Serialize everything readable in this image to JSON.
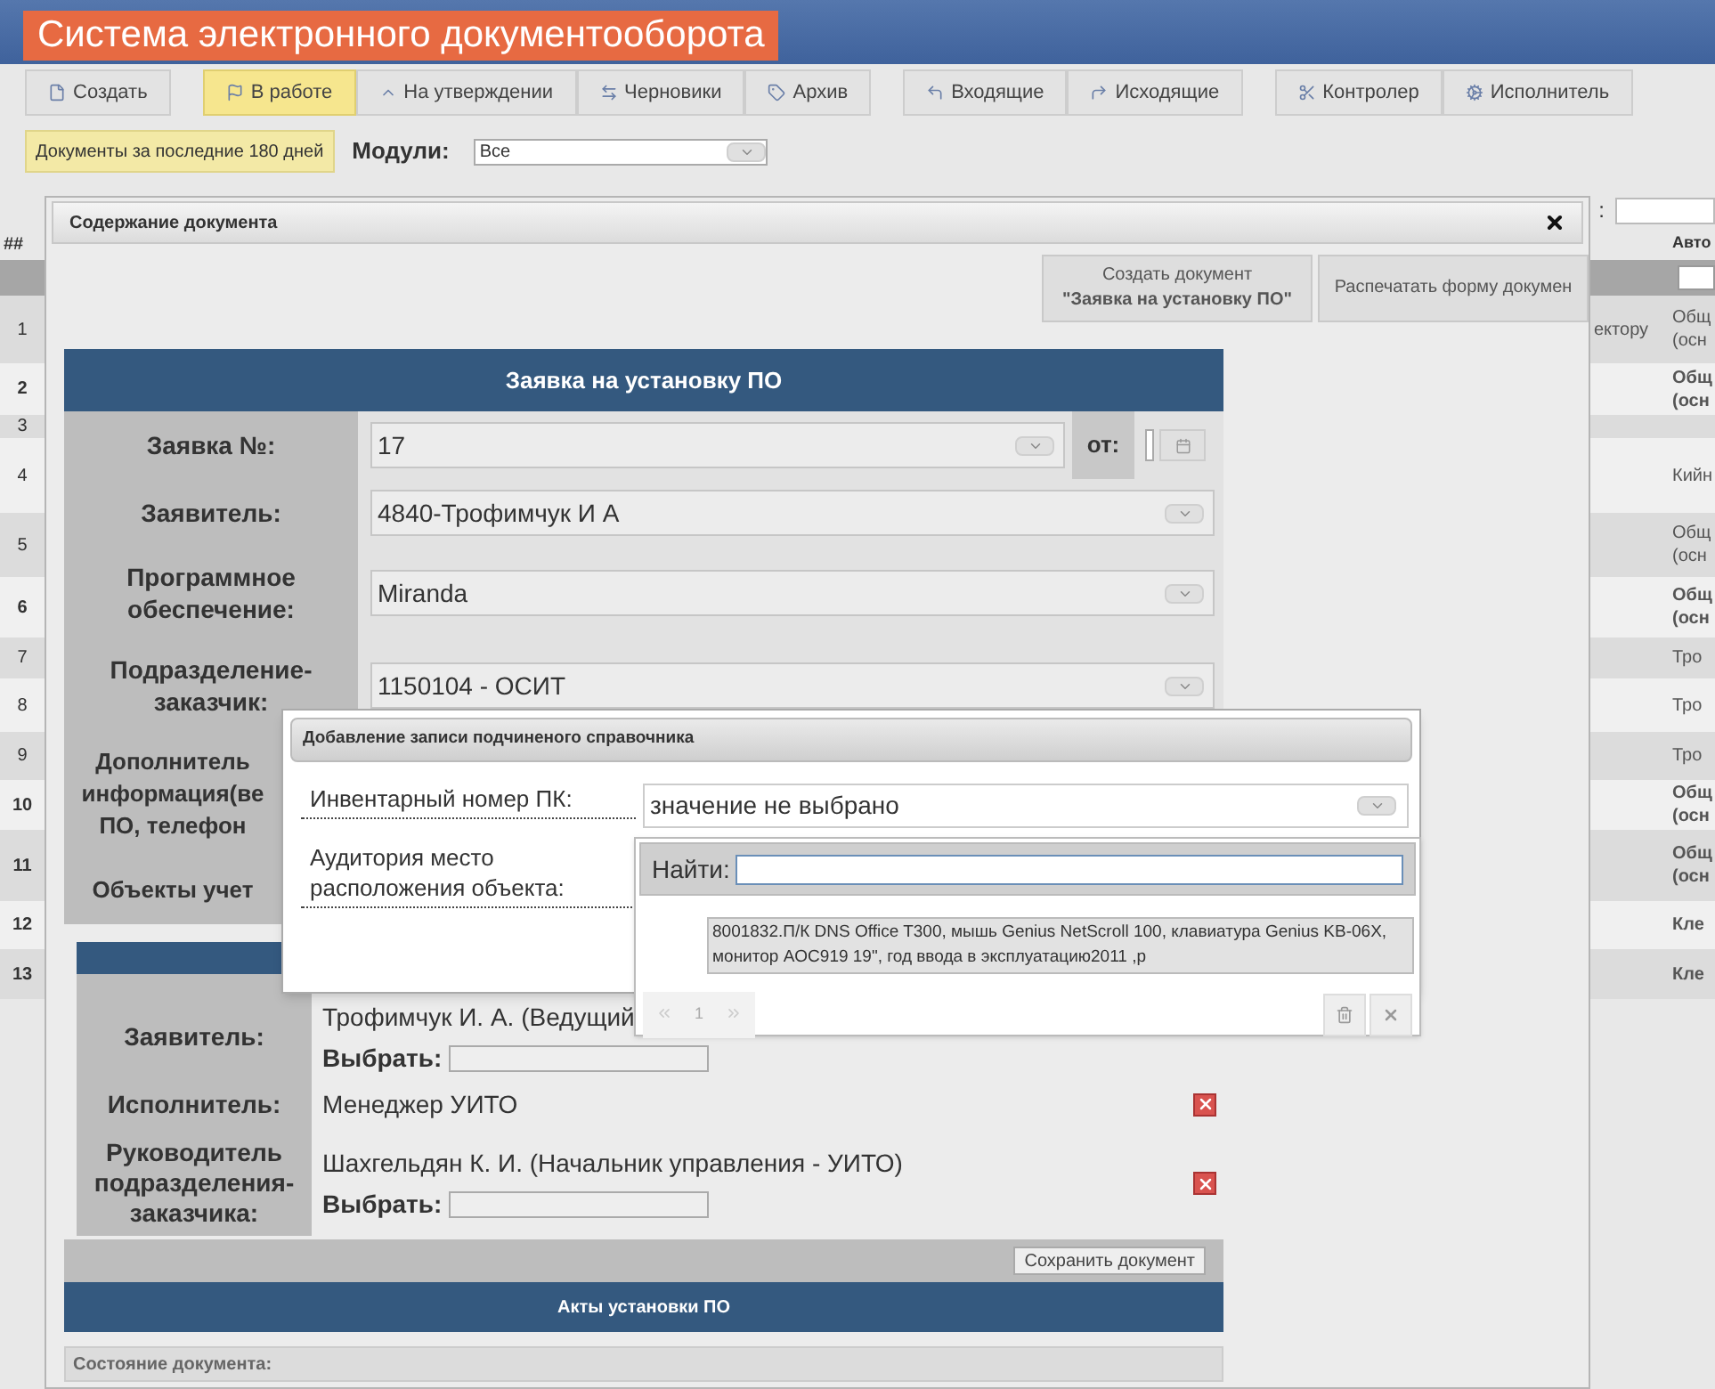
{
  "app_title": "Система электронного документооборота",
  "toolbar_groups": [
    [
      {
        "label": "Создать",
        "selected": false
      }
    ],
    [
      {
        "label": "В работе",
        "selected": true
      },
      {
        "label": "На утверждении",
        "selected": false
      },
      {
        "label": "Черновики",
        "selected": false
      },
      {
        "label": "Архив",
        "selected": false
      }
    ],
    [
      {
        "label": "Входящие",
        "selected": false
      },
      {
        "label": "Исходящие",
        "selected": false
      }
    ],
    [
      {
        "label": "Контролер",
        "selected": false
      },
      {
        "label": "Исполнитель",
        "selected": false
      }
    ]
  ],
  "filter": {
    "period": "Документы за последние 180 дней",
    "modules_label": "Модули:",
    "modules_value": "Все"
  },
  "search_colon": ":",
  "background_table": {
    "column_1": "##",
    "column_3": "Авто",
    "rows": [
      {
        "number": "1",
        "bold": false,
        "column_2": "ектору",
        "column_3": [
          "Общ",
          "(осн"
        ]
      },
      {
        "number": "2",
        "bold": true,
        "column_3": [
          "Общ",
          "(осн"
        ]
      },
      {
        "number": "3",
        "bold": false
      },
      {
        "number": "4",
        "bold": false,
        "column_3": [
          "Кийн"
        ]
      },
      {
        "number": "5",
        "bold": false,
        "column_3": [
          "Общ",
          "(осн"
        ]
      },
      {
        "number": "6",
        "bold": true,
        "column_3": [
          "Общ",
          "(осн"
        ]
      },
      {
        "number": "7",
        "bold": false,
        "column_3": [
          "Тро"
        ]
      },
      {
        "number": "8",
        "bold": false,
        "column_3": [
          "Тро"
        ]
      },
      {
        "number": "9",
        "bold": false,
        "column_3": [
          "Тро"
        ]
      },
      {
        "number": "10",
        "bold": true,
        "column_3": [
          "Общ",
          "(осн"
        ]
      },
      {
        "number": "11",
        "bold": true,
        "column_3": [
          "Общ",
          "(осн"
        ]
      },
      {
        "number": "12",
        "bold": true,
        "column_3": [
          "Кле"
        ]
      },
      {
        "number": "13",
        "bold": true,
        "column_3": [
          "Кле"
        ]
      }
    ]
  },
  "dialog": {
    "title": "Содержание документа",
    "buttons": [
      {
        "line_1": "Создать документ",
        "line_2": "\"Заявка на установку ПО\""
      },
      {
        "line_1": "Распечатать форму докумен"
      }
    ],
    "form": {
      "title": "Заявка на установку ПО",
      "fields": [
        {
          "kind": "number",
          "label": "Заявка №:",
          "value": "17",
          "date_label": "от:"
        },
        {
          "kind": "select",
          "label": "Заявитель:",
          "value": "4840-Трофимчук И А"
        },
        {
          "kind": "select",
          "label": "Программное обеспечение:",
          "value": "Miranda"
        },
        {
          "kind": "select",
          "label": "Подразделение-заказчик:",
          "value": "1150104 - ОСИТ"
        },
        {
          "kind": "covered",
          "label_lines": [
            "Дополнитель",
            "информация(ве",
            "ПО, телефон"
          ]
        },
        {
          "kind": "covered",
          "label_lines": [
            "Объекты учет"
          ]
        }
      ]
    },
    "approvals": [
      {
        "label": "Заявитель:",
        "value": "Трофимчук И. А. (Ведущий",
        "choose_label": "Выбрать:",
        "removable": false
      },
      {
        "label": "Исполнитель:",
        "value": "Менеджер УИТО",
        "removable": true
      },
      {
        "label": "Руководитель подразделения-заказчика:",
        "value": "Шахгельдян К. И. (Начальник управления - УИТО)",
        "choose_label": "Выбрать:",
        "removable": true
      }
    ],
    "save_button": "Сохранить документ",
    "acts_title": "Акты установки ПО",
    "status_label": "Состояние документа:"
  },
  "subdialog": {
    "title": "Добавление записи подчиненого справочника",
    "fields": [
      {
        "label": "Инвентарный номер ПК:",
        "value": "значение не выбрано"
      },
      {
        "label": "Аудитория место расположения объекта:"
      }
    ]
  },
  "dropdown": {
    "search_label": "Найти:",
    "options": [
      "8001832.П/К DNS Office T300, мышь Genius NetScroll 100, клавиатура Genius KB-06X, монитор AOC919 19\", год ввода в эксплуатацию2011 ,р"
    ],
    "page": "1"
  }
}
